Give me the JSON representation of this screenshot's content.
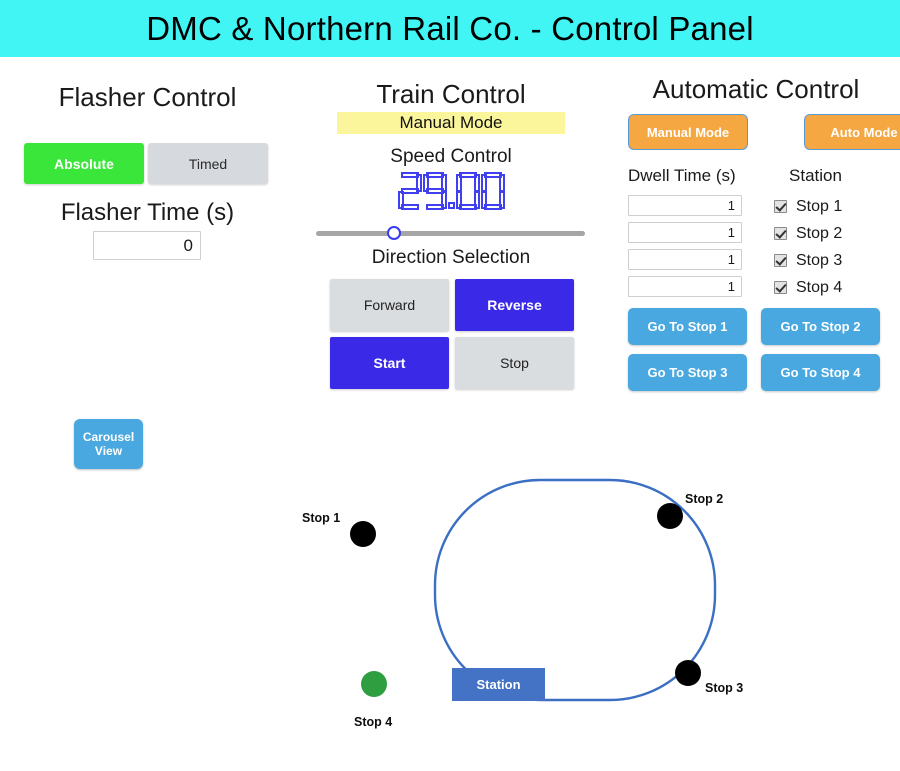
{
  "header": {
    "title": "DMC & Northern Rail Co. - Control Panel",
    "background_color": "#42f5f5"
  },
  "flasher_control": {
    "title": "Flasher Control",
    "modes": [
      {
        "label": "Absolute",
        "active": true,
        "color": "#3ae63a"
      },
      {
        "label": "Timed",
        "active": false,
        "color": "#d6dade"
      }
    ],
    "time_label": "Flasher Time (s)",
    "time_value": "0",
    "time_placeholder": "0"
  },
  "carousel": {
    "line1": "Carousel",
    "line2": "View",
    "color": "#4aa8e0"
  },
  "train_control": {
    "title": "Train Control",
    "mode_banner": "Manual Mode",
    "mode_banner_color": "#fbf59b",
    "speed_label": "Speed Control",
    "speed_value": "29.00",
    "speed_color": "#4040f0",
    "slider_percent": 29,
    "direction_label": "Direction Selection",
    "buttons": [
      {
        "label": "Forward",
        "active": false
      },
      {
        "label": "Reverse",
        "active": true
      },
      {
        "label": "Start",
        "active": true
      },
      {
        "label": "Stop",
        "active": false
      }
    ],
    "active_color": "#3a2ae8",
    "inactive_color": "#d9dde0"
  },
  "automatic_control": {
    "title": "Automatic Control",
    "mode_buttons": [
      {
        "label": "Manual Mode"
      },
      {
        "label": "Auto Mode"
      }
    ],
    "mode_button_color": "#f5a742",
    "dwell_header": "Dwell Time (s)",
    "station_header": "Station",
    "dwell_times": [
      "1",
      "1",
      "1",
      "1"
    ],
    "stations": [
      {
        "label": "Stop 1",
        "checked": true
      },
      {
        "label": "Stop 2",
        "checked": true
      },
      {
        "label": "Stop 3",
        "checked": true
      },
      {
        "label": "Stop 4",
        "checked": true
      }
    ],
    "goto_buttons": [
      {
        "label": "Go To Stop 1"
      },
      {
        "label": "Go To Stop 2"
      },
      {
        "label": "Go To Stop 3"
      },
      {
        "label": "Go To Stop 4"
      }
    ],
    "goto_color": "#4aa8e0"
  },
  "track": {
    "line_color": "#3a6fc4",
    "station_label": "Station",
    "station_color": "#4472c4",
    "stops": [
      {
        "label": "Stop 1",
        "color": "#000000",
        "active": false
      },
      {
        "label": "Stop 2",
        "color": "#000000",
        "active": false
      },
      {
        "label": "Stop 3",
        "color": "#000000",
        "active": false
      },
      {
        "label": "Stop 4",
        "color": "#2f9e41",
        "active": true
      }
    ]
  }
}
